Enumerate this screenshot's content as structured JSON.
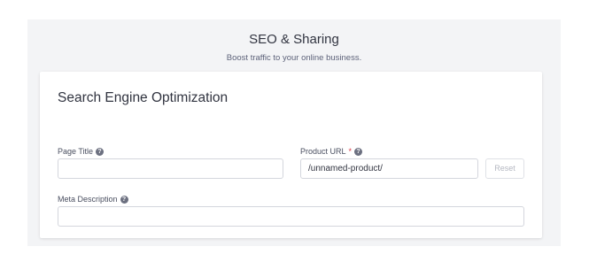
{
  "section": {
    "title": "SEO & Sharing",
    "subtitle": "Boost traffic to your online business."
  },
  "seo_card": {
    "title": "Search Engine Optimization",
    "page_title": {
      "label": "Page Title",
      "value": "",
      "help_icon": "question-circle-icon"
    },
    "product_url": {
      "label": "Product URL",
      "required_mark": "*",
      "value": "/unnamed-product/",
      "help_icon": "question-circle-icon"
    },
    "reset_label": "Reset",
    "meta_description": {
      "label": "Meta Description",
      "value": "",
      "help_icon": "question-circle-icon"
    }
  },
  "colors": {
    "section_background": "#f3f4f6",
    "card_background": "#ffffff",
    "required_mark": "#db3643",
    "disabled_text": "#b5b8c2"
  }
}
